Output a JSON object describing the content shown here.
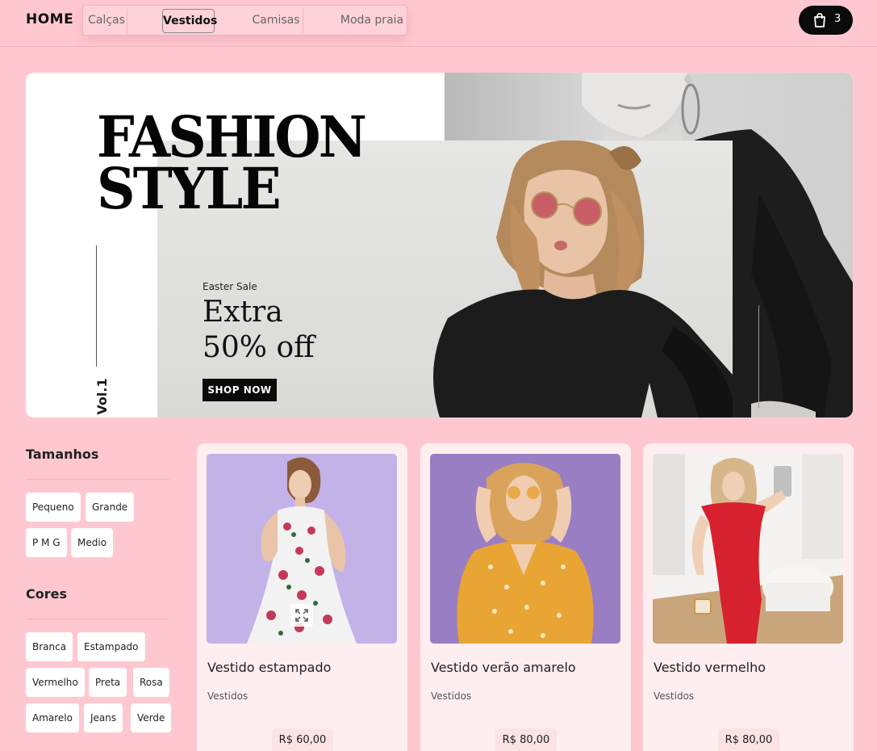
{
  "header": {
    "home_label": "HOME",
    "nav": [
      {
        "label": "Calças",
        "active": false
      },
      {
        "label": "Vestidos",
        "active": true
      },
      {
        "label": "Camisas",
        "active": false
      },
      {
        "label": "Moda praia",
        "active": false
      }
    ],
    "cart_count": "3",
    "cart_icon": "shopping-bag-icon"
  },
  "hero": {
    "title_line1": "FASHION",
    "title_line2": "STYLE",
    "volume": "Vol.1",
    "subtitle": "Easter Sale",
    "offer_line1": "Extra",
    "offer_line2": "50% off",
    "cta": "SHOP NOW"
  },
  "sidebar": {
    "sizes_title": "Tamanhos",
    "sizes": [
      "Pequeno",
      "Grande",
      "P M G",
      "Medio"
    ],
    "colors_title": "Cores",
    "colors": [
      "Branca",
      "Estampado",
      "Vermelho",
      "Preta",
      "Rosa",
      "Amarelo",
      "Jeans",
      "Verde"
    ]
  },
  "products": [
    {
      "name": "Vestido estampado",
      "category": "Vestidos",
      "price": "R$ 60,00"
    },
    {
      "name": "Vestido verão amarelo",
      "category": "Vestidos",
      "price": "R$ 80,00"
    },
    {
      "name": "Vestido vermelho",
      "category": "Vestidos",
      "price": "R$ 80,00"
    }
  ],
  "colors": {
    "page_background": "#ffc8d0",
    "card_background": "#ffeef0",
    "cart_button": "#0b0b0b"
  }
}
